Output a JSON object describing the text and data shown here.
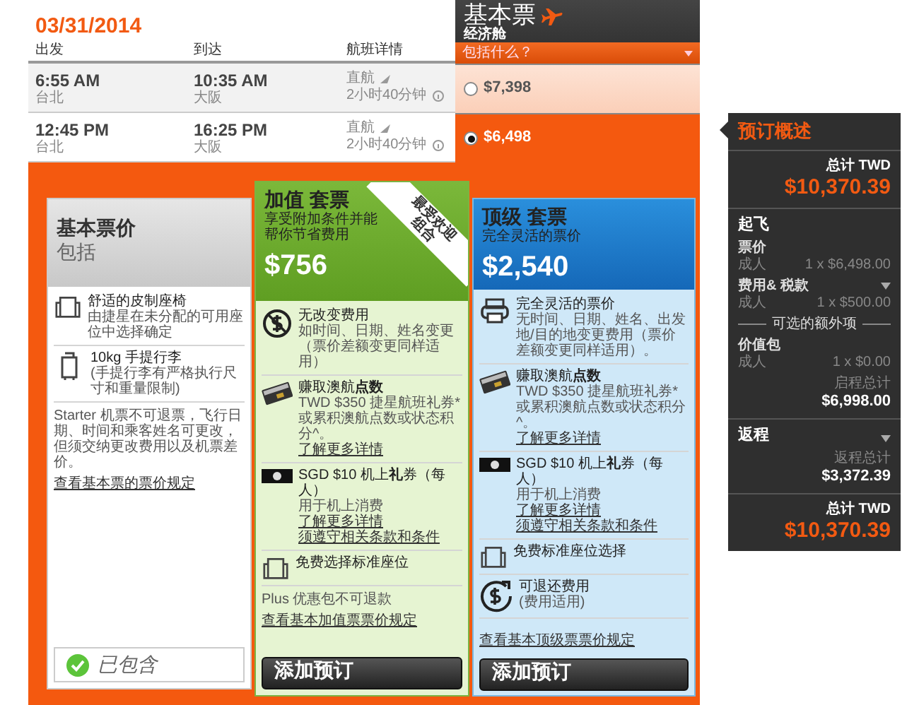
{
  "date": "03/31/2014",
  "flight_columns": [
    "出发",
    "到达",
    "航班详情"
  ],
  "fare_header": {
    "title": "基本票",
    "subtitle": "经济舱",
    "dropdown": "包括什么？"
  },
  "flights": [
    {
      "depart_time": "6:55 AM",
      "depart_city": "台北",
      "arrive_time": "10:35 AM",
      "arrive_city": "大阪",
      "stops": "直航",
      "duration": "2小时40分钟",
      "fare": "$7,398",
      "selected": false
    },
    {
      "depart_time": "12:45 PM",
      "depart_city": "台北",
      "arrive_time": "16:25 PM",
      "arrive_city": "大阪",
      "stops": "直航",
      "duration": "2小时40分钟",
      "fare": "$6,498",
      "selected": true
    }
  ],
  "packages": [
    {
      "kind": "basic",
      "title": "基本票价",
      "subtitle": "包括",
      "features": [
        {
          "kind": "seat",
          "title": "舒适的皮制座椅",
          "text": "由捷星在未分配的可用座位中选择确定"
        },
        {
          "kind": "suitcase",
          "title": "10kg 手提行李",
          "text": "(手提行李有严格执行尺寸和重量限制)"
        }
      ],
      "note": "Starter 机票不可退票，飞行日期、时间和乘客姓名可更改，但须交纳更改费用以及机票差价。",
      "rules_link": "查看基本票的票价规定",
      "footer": {
        "kind": "status",
        "label": "已包含"
      }
    },
    {
      "kind": "plus",
      "title": "加值 套票",
      "subtitle": "享受附加条件并能帮你节省费用",
      "price": "$756",
      "ribbon": [
        "最受欢迎",
        "组合"
      ],
      "features": [
        {
          "kind": "no-fee",
          "title": "无改变费用",
          "text": "如时间、日期、姓名变更（票价差额变更同样适用）"
        },
        {
          "kind": "card",
          "title": "赚取澳航**点数**",
          "text": "TWD $350 捷星航班礼券* 或累积澳航点数或状态积分^。",
          "links": [
            "了解更多详情"
          ]
        },
        {
          "kind": "cash",
          "title": "SGD $10 机上**礼**券（每人）",
          "text": "用于机上消费",
          "links": [
            "了解更多详情",
            "须遵守相关条款和条件"
          ]
        },
        {
          "kind": "seat",
          "title": "免费选择标准座位"
        }
      ],
      "note": "Plus 优惠包不可退款",
      "rules_link": "查看基本加值票票价规定",
      "footer": {
        "kind": "button",
        "label": "添加预订"
      }
    },
    {
      "kind": "max",
      "title": "顶级 套票",
      "subtitle": "完全灵活的票价",
      "price": "$2,540",
      "features": [
        {
          "kind": "ticket",
          "title": "完全灵活的票价",
          "text": "无时间、日期、姓名、出发地/目的地变更费用（票价差额变更同样适用）。"
        },
        {
          "kind": "card",
          "title": "赚取澳航**点数**",
          "text": "TWD $350 捷星航班礼券* 或累积澳航点数或状态积分^。",
          "links": [
            "了解更多详情"
          ]
        },
        {
          "kind": "cash",
          "title": "SGD $10 机上**礼**券（每人）",
          "text": "用于机上消费",
          "links": [
            "了解更多详情",
            "须遵守相关条款和条件"
          ]
        },
        {
          "kind": "seat",
          "title": "免费标准座位选择"
        },
        {
          "kind": "refund",
          "title": "可退还费用",
          "text": "(费用适用)"
        }
      ],
      "rules_link": "查看基本顶级票票价规定",
      "footer": {
        "kind": "button",
        "label": "添加预订"
      }
    }
  ],
  "summary": {
    "title": "预订概述",
    "total_label": "总计 TWD",
    "total": "$10,370.39",
    "departure": {
      "heading": "起飞",
      "lines": [
        {
          "label": "票价",
          "who": "成人",
          "amount": "1 x $6,498.00",
          "collapsible": false
        },
        {
          "label": "费用& 税款",
          "who": "成人",
          "amount": "1 x $500.00",
          "collapsible": true
        }
      ],
      "extras_heading": "可选的额外项",
      "extras": [
        {
          "label": "价值包",
          "who": "成人",
          "amount": "1 x $0.00",
          "collapsible": false
        }
      ],
      "subtotal_label": "启程总计",
      "subtotal": "$6,998.00"
    },
    "return": {
      "heading": "返程",
      "collapsible": true,
      "subtotal_label": "返程总计",
      "subtotal": "$3,372.39"
    },
    "bottom_total_label": "总计 TWD",
    "bottom_total": "$10,370.39"
  }
}
